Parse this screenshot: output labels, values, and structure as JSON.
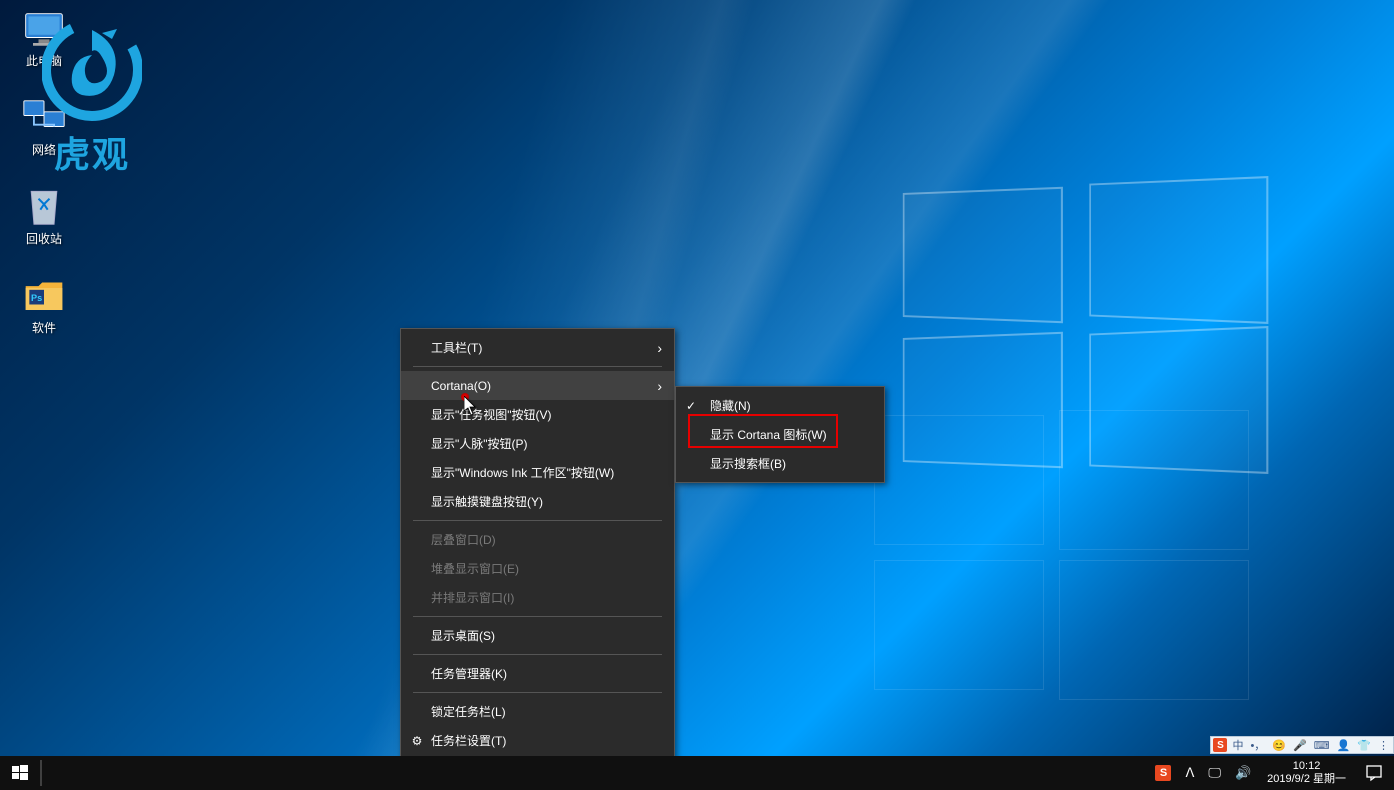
{
  "desktop_icons": [
    {
      "name": "this-pc",
      "label": "此电脑"
    },
    {
      "name": "network",
      "label": "网络"
    },
    {
      "name": "recycle-bin",
      "label": "回收站"
    },
    {
      "name": "software-folder",
      "label": "软件"
    }
  ],
  "watermark_text": "虎观",
  "context_menu": {
    "items": [
      {
        "label": "工具栏(T)",
        "type": "sub",
        "name": "toolbars"
      },
      {
        "type": "sep"
      },
      {
        "label": "Cortana(O)",
        "type": "sub",
        "name": "cortana",
        "hovered": true
      },
      {
        "label": "显示\"任务视图\"按钮(V)",
        "type": "item",
        "name": "taskview"
      },
      {
        "label": "显示\"人脉\"按钮(P)",
        "type": "item",
        "name": "people"
      },
      {
        "label": "显示\"Windows Ink 工作区\"按钮(W)",
        "type": "item",
        "name": "ink"
      },
      {
        "label": "显示触摸键盘按钮(Y)",
        "type": "item",
        "name": "touchkb"
      },
      {
        "type": "sep"
      },
      {
        "label": "层叠窗口(D)",
        "type": "disabled",
        "name": "cascade"
      },
      {
        "label": "堆叠显示窗口(E)",
        "type": "disabled",
        "name": "stacked"
      },
      {
        "label": "并排显示窗口(I)",
        "type": "disabled",
        "name": "sidebyside"
      },
      {
        "type": "sep"
      },
      {
        "label": "显示桌面(S)",
        "type": "item",
        "name": "showdesktop"
      },
      {
        "type": "sep"
      },
      {
        "label": "任务管理器(K)",
        "type": "item",
        "name": "taskmgr"
      },
      {
        "type": "sep"
      },
      {
        "label": "锁定任务栏(L)",
        "type": "item",
        "name": "lock"
      },
      {
        "label": "任务栏设置(T)",
        "type": "item",
        "name": "settings",
        "pre_icon": "gear"
      }
    ]
  },
  "sub_menu": {
    "items": [
      {
        "label": "隐藏(N)",
        "checked": true,
        "name": "hide"
      },
      {
        "label": "显示 Cortana 图标(W)",
        "checked": false,
        "name": "show-icon",
        "highlighted": true
      },
      {
        "label": "显示搜索框(B)",
        "checked": false,
        "name": "show-box"
      }
    ]
  },
  "ime": {
    "sogou": "S",
    "zhong": "中",
    "punct": "•，",
    "face": "😊",
    "mic": "🎤",
    "kbd": "⌨",
    "person": "👤",
    "cloth": "👕",
    "more": "⋮"
  },
  "tray": {
    "sogou": "S",
    "up": "ᐱ",
    "net": "🖵",
    "vol": "🔊"
  },
  "clock": {
    "time": "10:12",
    "date": "2019/9/2 星期一"
  }
}
